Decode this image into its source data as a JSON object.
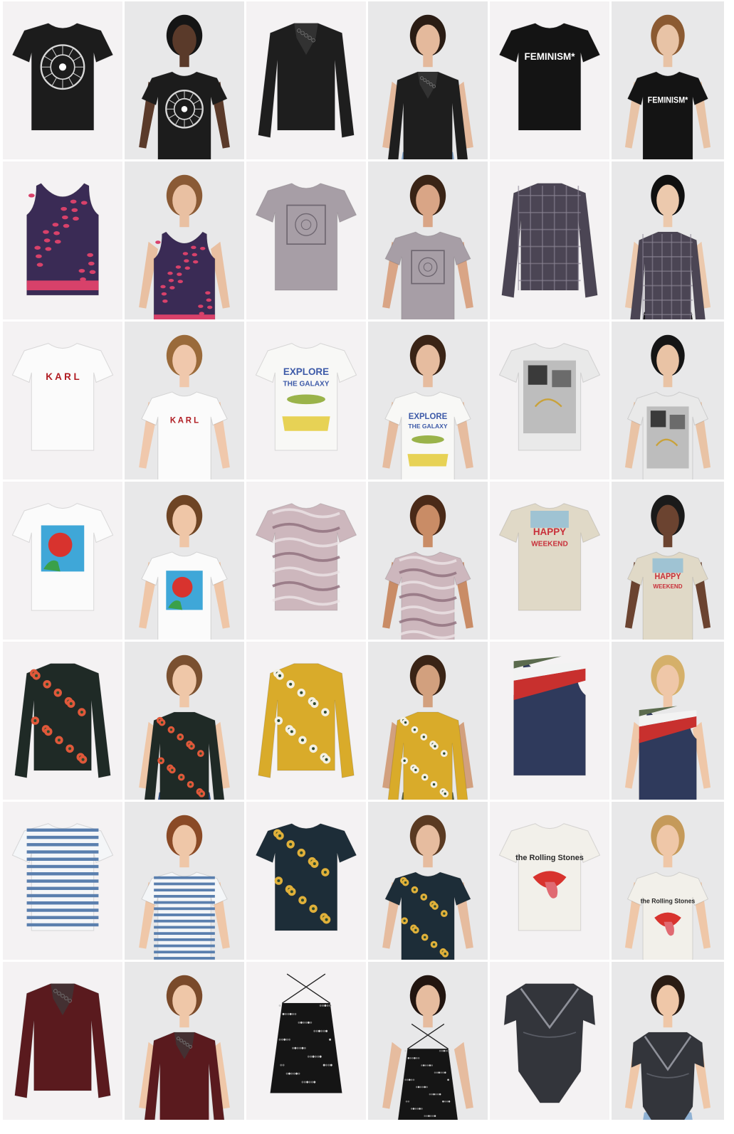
{
  "tiles": [
    {
      "row": 1,
      "col": 1,
      "kind": "product",
      "garment": "tshirt",
      "color": "#1c1c1c",
      "print": "zodiac-wheel"
    },
    {
      "row": 1,
      "col": 2,
      "kind": "model",
      "garment": "tshirt",
      "color": "#1c1c1c",
      "print": "zodiac-wheel",
      "bottom": "#222222",
      "skin": "#5a3a2a",
      "hair": "#151515"
    },
    {
      "row": 1,
      "col": 3,
      "kind": "product",
      "garment": "longsleeve",
      "color": "#1e1e1e",
      "print": "lace-neck"
    },
    {
      "row": 1,
      "col": 4,
      "kind": "model",
      "garment": "longsleeve",
      "color": "#1e1e1e",
      "print": "lace-neck",
      "bottom": "#7fa2c8",
      "skin": "#e4b99c",
      "hair": "#2a1c14"
    },
    {
      "row": 1,
      "col": 5,
      "kind": "product",
      "garment": "tshirt",
      "color": "#141414",
      "print": "text",
      "print_text": "FEMINISM*"
    },
    {
      "row": 1,
      "col": 6,
      "kind": "model",
      "garment": "tshirt",
      "color": "#141414",
      "print": "text",
      "print_text": "FEMINISM*",
      "bottom": "#ece8dc",
      "skin": "#e8c3a6",
      "hair": "#8b5a32"
    },
    {
      "row": 2,
      "col": 1,
      "kind": "product",
      "garment": "tank",
      "color": "#3a2b55",
      "print": "leopard",
      "accent": "#d8416a"
    },
    {
      "row": 2,
      "col": 2,
      "kind": "model",
      "garment": "tank",
      "color": "#3a2b55",
      "print": "leopard",
      "accent": "#d8416a",
      "bottom": "#7aa0c8",
      "skin": "#e9c0a2",
      "hair": "#8a5a35"
    },
    {
      "row": 2,
      "col": 3,
      "kind": "product",
      "garment": "tshirt",
      "color": "#a79ea6",
      "print": "bandana"
    },
    {
      "row": 2,
      "col": 4,
      "kind": "model",
      "garment": "tshirt",
      "color": "#a79ea6",
      "print": "bandana",
      "bottom": "#111111",
      "skin": "#d9a586",
      "hair": "#3a2416"
    },
    {
      "row": 2,
      "col": 5,
      "kind": "product",
      "garment": "longsleeve",
      "color": "#4b4554",
      "print": "plaid"
    },
    {
      "row": 2,
      "col": 6,
      "kind": "model",
      "garment": "longsleeve",
      "color": "#4b4554",
      "print": "plaid",
      "bottom": "#111111",
      "skin": "#ecc9ad",
      "hair": "#101010"
    },
    {
      "row": 3,
      "col": 1,
      "kind": "product",
      "garment": "tshirt",
      "color": "#fbfbfb",
      "print": "text",
      "print_text": "K A R L",
      "print_color": "#b01c22"
    },
    {
      "row": 3,
      "col": 2,
      "kind": "model",
      "garment": "tshirt",
      "color": "#fbfbfb",
      "print": "text",
      "print_text": "K A R L",
      "print_color": "#b01c22",
      "bottom": "#222222",
      "skin": "#f0c8ac",
      "hair": "#9a6a3a"
    },
    {
      "row": 3,
      "col": 3,
      "kind": "product",
      "garment": "tshirt",
      "color": "#f8f8f6",
      "print": "text",
      "print_text": "EXPLORE",
      "sub_text": "THE GALAXY",
      "print_color": "#3d5aa8"
    },
    {
      "row": 3,
      "col": 4,
      "kind": "model",
      "garment": "tshirt",
      "color": "#f8f8f6",
      "print": "text",
      "print_text": "EXPLORE",
      "sub_text": "THE GALAXY",
      "print_color": "#3d5aa8",
      "bottom": "#a6c0db",
      "skin": "#e6bc9f",
      "hair": "#3a2416"
    },
    {
      "row": 3,
      "col": 5,
      "kind": "product",
      "garment": "tshirt",
      "color": "#e9e9e9",
      "print": "collage"
    },
    {
      "row": 3,
      "col": 6,
      "kind": "model",
      "garment": "tshirt",
      "color": "#e9e9e9",
      "print": "collage",
      "bottom": "#4d6f9a",
      "skin": "#e9c3a5",
      "hair": "#151515"
    },
    {
      "row": 4,
      "col": 1,
      "kind": "product",
      "garment": "tshirt",
      "color": "#fbfbfb",
      "print": "rose"
    },
    {
      "row": 4,
      "col": 2,
      "kind": "model",
      "garment": "tshirt",
      "color": "#fbfbfb",
      "print": "rose",
      "bottom": "#7a3018",
      "skin": "#efc6a7",
      "hair": "#6e4424"
    },
    {
      "row": 4,
      "col": 3,
      "kind": "product",
      "garment": "tshirt",
      "color": "#cdb7bd",
      "print": "marble"
    },
    {
      "row": 4,
      "col": 4,
      "kind": "model",
      "garment": "tshirt",
      "color": "#cdb7bd",
      "print": "marble",
      "bottom": "#2c3b5e",
      "skin": "#c98c66",
      "hair": "#4a2a18"
    },
    {
      "row": 4,
      "col": 5,
      "kind": "product",
      "garment": "tshirt",
      "color": "#e0d9c7",
      "print": "text",
      "print_text": "HAPPY",
      "sub_text": "WEEKEND",
      "print_color": "#c8303a"
    },
    {
      "row": 4,
      "col": 6,
      "kind": "model",
      "garment": "tshirt",
      "color": "#e0d9c7",
      "print": "text",
      "print_text": "HAPPY",
      "sub_text": "WEEKEND",
      "print_color": "#c8303a",
      "bottom": "#111111",
      "skin": "#6b4330",
      "hair": "#1a1a1a"
    },
    {
      "row": 5,
      "col": 1,
      "kind": "product",
      "garment": "longsleeve",
      "color": "#1f2a26",
      "print": "floral",
      "accent": "#e0583a"
    },
    {
      "row": 5,
      "col": 2,
      "kind": "model",
      "garment": "longsleeve",
      "color": "#1f2a26",
      "print": "floral",
      "accent": "#e0583a",
      "bottom": "#2b4a7c",
      "skin": "#efc7a8",
      "hair": "#7a5030"
    },
    {
      "row": 5,
      "col": 3,
      "kind": "product",
      "garment": "longsleeve",
      "color": "#d9ab2a",
      "print": "floral",
      "accent": "#f3f0e4"
    },
    {
      "row": 5,
      "col": 4,
      "kind": "model",
      "garment": "longsleeve",
      "color": "#d9ab2a",
      "print": "floral",
      "accent": "#f3f0e4",
      "bottom": "#585f3c",
      "skin": "#d2a07e",
      "hair": "#3a2416"
    },
    {
      "row": 5,
      "col": 5,
      "kind": "product",
      "garment": "tank",
      "color": "#2f3a5c",
      "print": "chevron",
      "accent": "#c8302e"
    },
    {
      "row": 5,
      "col": 6,
      "kind": "model",
      "garment": "tank",
      "color": "#2f3a5c",
      "print": "chevron",
      "accent": "#c8302e",
      "bottom": "#8a2420",
      "skin": "#efc7a8",
      "hair": "#d5b06a"
    },
    {
      "row": 6,
      "col": 1,
      "kind": "product",
      "garment": "tshirt",
      "color": "#f4f6f8",
      "print": "stripes",
      "accent": "#5a7fae"
    },
    {
      "row": 6,
      "col": 2,
      "kind": "model",
      "garment": "tshirt",
      "color": "#f4f6f8",
      "print": "stripes",
      "accent": "#5a7fae",
      "bottom": "#f4f4f4",
      "skin": "#efc7a8",
      "hair": "#8a4a26"
    },
    {
      "row": 6,
      "col": 3,
      "kind": "product",
      "garment": "tshirt",
      "color": "#1d2d38",
      "print": "floral",
      "accent": "#e0b03a"
    },
    {
      "row": 6,
      "col": 4,
      "kind": "model",
      "garment": "tshirt",
      "color": "#1d2d38",
      "print": "floral",
      "accent": "#e0b03a",
      "bottom": "#8fb1d3",
      "skin": "#e6bc9f",
      "hair": "#5a3a22"
    },
    {
      "row": 6,
      "col": 5,
      "kind": "product",
      "garment": "tshirt",
      "color": "#f2f0ea",
      "print": "text",
      "print_text": "the Rolling Stones",
      "print_color": "#2a2a2a"
    },
    {
      "row": 6,
      "col": 6,
      "kind": "model",
      "garment": "tshirt",
      "color": "#f2f0ea",
      "print": "text",
      "print_text": "the Rolling Stones",
      "print_color": "#2a2a2a",
      "bottom": "#1e2a44",
      "skin": "#efc7a8",
      "hair": "#c59a5a"
    },
    {
      "row": 7,
      "col": 1,
      "kind": "product",
      "garment": "longsleeve",
      "color": "#5a1a1e",
      "print": "lace-neck"
    },
    {
      "row": 7,
      "col": 2,
      "kind": "model",
      "garment": "longsleeve",
      "color": "#5a1a1e",
      "print": "lace-neck",
      "bottom": "#f0d8df",
      "skin": "#efc7a8",
      "hair": "#7a4a2a"
    },
    {
      "row": 7,
      "col": 3,
      "kind": "product",
      "garment": "cami",
      "color": "#151515",
      "print": "sequins"
    },
    {
      "row": 7,
      "col": 4,
      "kind": "model",
      "garment": "cami",
      "color": "#151515",
      "print": "sequins",
      "bottom": "#3f5e86",
      "skin": "#e6bc9f",
      "hair": "#221510"
    },
    {
      "row": 7,
      "col": 5,
      "kind": "product",
      "garment": "bodysuit",
      "color": "#33353b",
      "print": "wrap"
    },
    {
      "row": 7,
      "col": 6,
      "kind": "model",
      "garment": "bodysuit",
      "color": "#33353b",
      "print": "wrap",
      "bottom": "#8fb1d3",
      "skin": "#efc7a8",
      "hair": "#2a1c14"
    }
  ]
}
